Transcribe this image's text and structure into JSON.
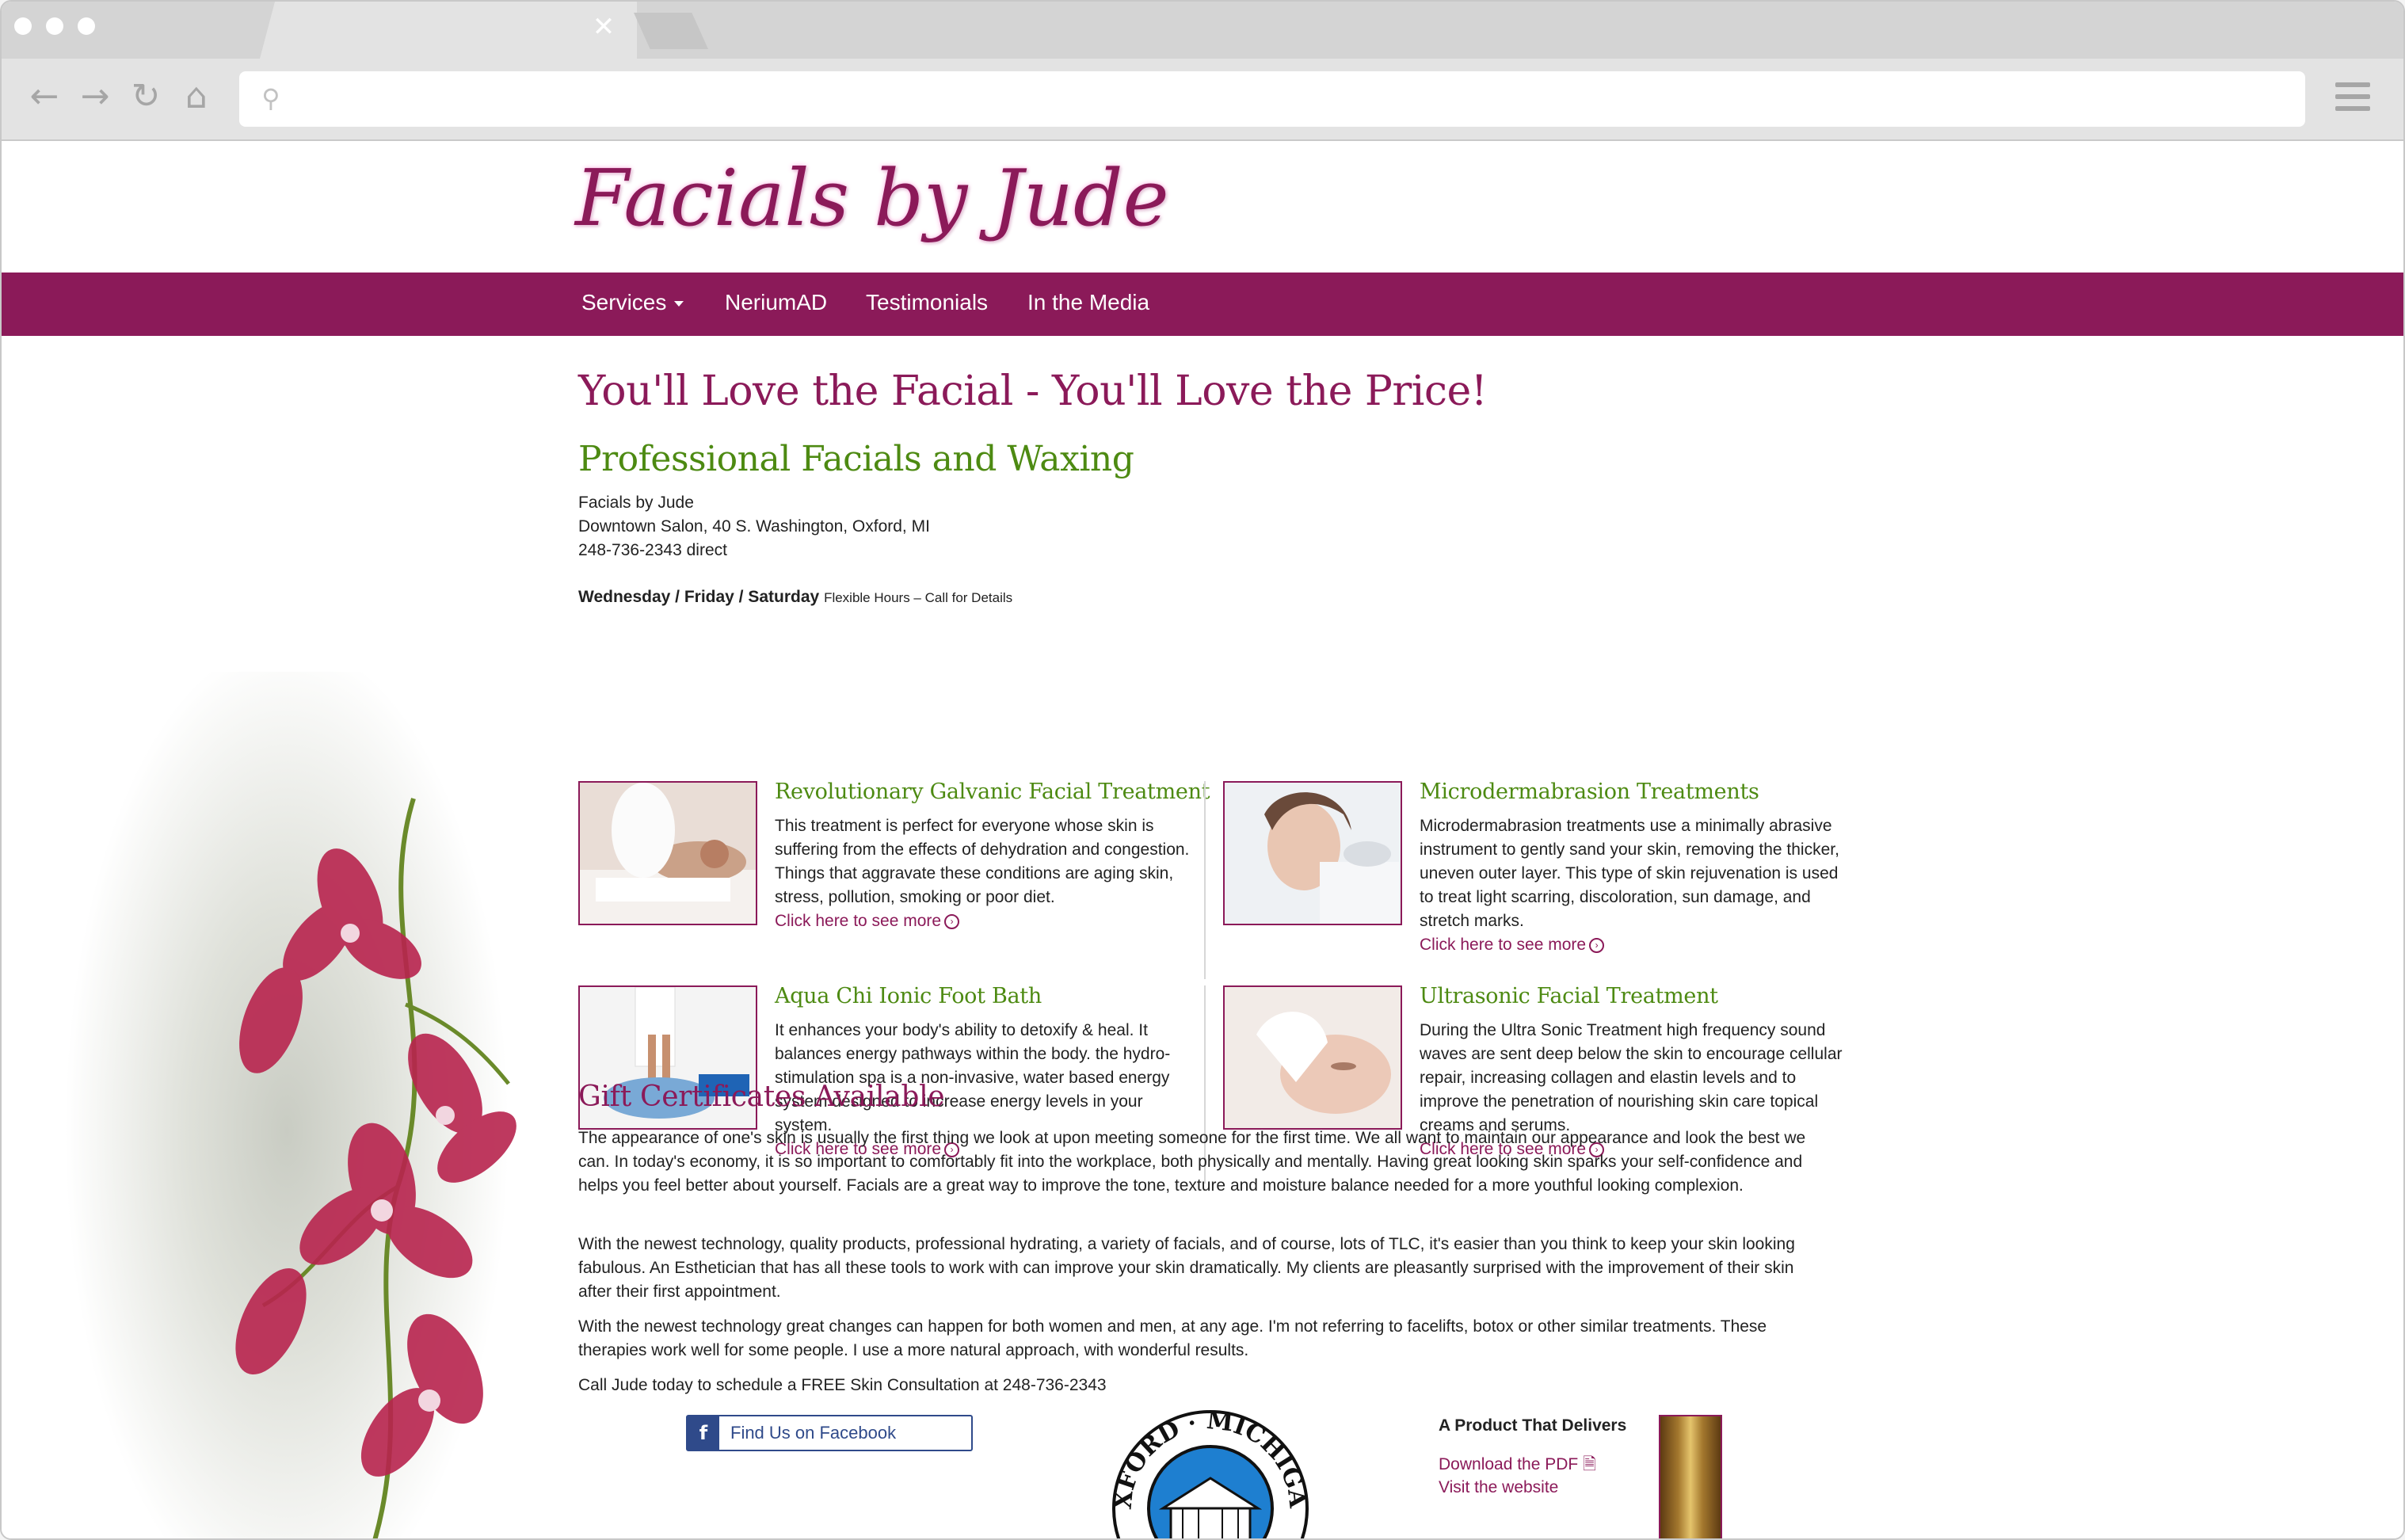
{
  "browser": {
    "url": ""
  },
  "site": {
    "logo_text": "Facials by Jude",
    "nav": [
      {
        "label": "Services",
        "has_dropdown": true
      },
      {
        "label": "NeriumAD"
      },
      {
        "label": "Testimonials"
      },
      {
        "label": "In the Media"
      }
    ]
  },
  "main": {
    "headline": "You'll Love the Facial - You'll Love the Price!",
    "subheadline": "Professional Facials and Waxing",
    "address": {
      "name": "Facials by Jude",
      "street": "Downtown Salon, 40 S. Washington, Oxford, MI",
      "phone": "248-736-2343 direct"
    },
    "hours": {
      "days": "Wednesday / Friday / Saturday",
      "note": "Flexible Hours – Call for Details"
    },
    "services": [
      {
        "title": "Revolutionary Galvanic Facial Treatment",
        "text": "This treatment is perfect for everyone whose skin is suffering from the effects of dehydration and congestion. Things that aggravate these conditions are aging skin, stress, pollution, smoking or poor diet.",
        "link": "Click here to see more"
      },
      {
        "title": "Microdermabrasion Treatments",
        "text": "Microdermabrasion treatments use a minimally abrasive instrument to gently sand your skin, removing the thicker, uneven outer layer. This type of skin rejuvenation is used to treat light scarring, discoloration, sun damage, and stretch marks.",
        "link": "Click here to see more"
      },
      {
        "title": "Aqua Chi Ionic Foot Bath",
        "text": "It enhances your body's ability to detoxify & heal. It balances energy pathways within the body. the hydro-stimulation spa is a non-invasive, water based energy system designed to increase energy levels in your system.",
        "link": "Click here to see more"
      },
      {
        "title": "Ultrasonic Facial Treatment",
        "text": "During the Ultra Sonic Treatment high frequency sound waves are sent deep below the skin to encourage cellular repair, increasing collagen and elastin levels and to improve the penetration of nourishing skin care topical creams and serums.",
        "link": "Click here to see more"
      }
    ],
    "gift_title": "Gift Certificates Available",
    "paragraphs": [
      "The appearance of one's skin is usually the first thing we look at upon meeting someone for the first time. We all want to maintain our appearance and look the best we can. In today's economy, it is so important to comfortably fit into the workplace, both physically and mentally. Having great looking skin sparks your self-confidence and helps you feel better about yourself. Facials are a great way to improve the tone, texture and moisture balance needed for a more youthful looking complexion.",
      "With the newest technology, quality products, professional hydrating, a variety of facials, and of course, lots of TLC, it's easier than you think to keep your skin looking fabulous. An Esthetician that has all these tools to work with can improve your skin dramatically. My clients are pleasantly surprised with the improvement of their skin after their first appointment.",
      "With the newest technology great changes can happen for both women and men, at any age. I'm not referring to facelifts, botox or other similar treatments. These therapies work well for some people. I use a more natural approach, with wonderful results.",
      "Call Jude today to schedule a FREE Skin Consultation at 248-736-2343"
    ],
    "facebook_label": "Find Us on Facebook",
    "seal_text": "OXFORD · MICHIGAN",
    "product": {
      "heading": "A Product That Delivers",
      "pdf_link": "Download the PDF",
      "site_link": "Visit the website"
    }
  },
  "colors": {
    "brand": "#8b1a59",
    "green": "#4d8a12",
    "facebook": "#2f4a8a"
  }
}
